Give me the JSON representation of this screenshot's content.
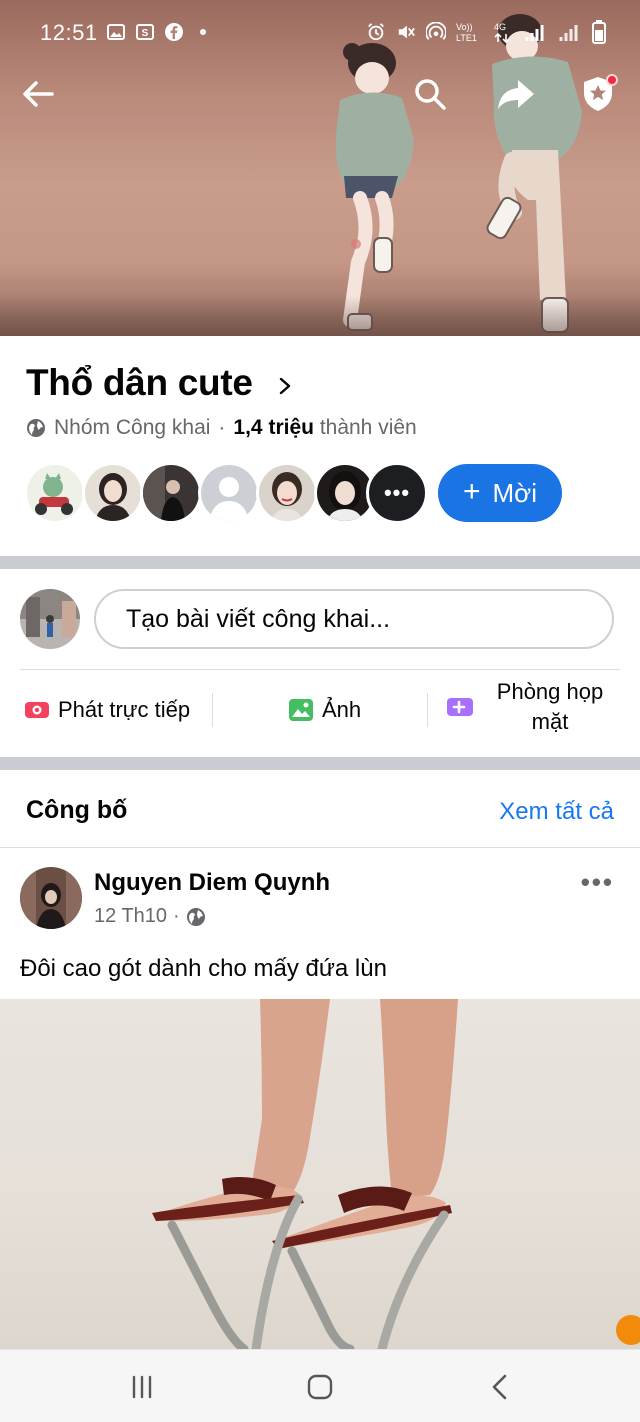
{
  "status_bar": {
    "time": "12:51",
    "left_icons": [
      "gallery-icon",
      "samsung-icon",
      "facebook-icon",
      "dot-icon"
    ],
    "right_icons": [
      "alarm-icon",
      "mute-icon",
      "hotspot-icon",
      "volte-icon",
      "signal-icon",
      "signal-icon",
      "battery-icon"
    ],
    "network_label": "4G",
    "volte_label": "Vo)) LTE1"
  },
  "cover": {
    "back_icon": "back-arrow-icon",
    "search_icon": "search-icon",
    "share_icon": "share-icon",
    "shield_icon": "shield-star-icon"
  },
  "group": {
    "name": "Thổ dân cute",
    "privacy_icon": "globe-icon",
    "privacy": "Nhóm Công khai",
    "separator": "·",
    "member_count": "1,4 triệu",
    "member_suffix": "thành viên",
    "more_members_label": "•••",
    "invite_label": "Mời",
    "invite_plus": "+"
  },
  "composer": {
    "placeholder": "Tạo bài viết công khai...",
    "actions": [
      {
        "label": "Phát trực tiếp",
        "icon": "live-video-icon",
        "color": "#f3425f"
      },
      {
        "label": "Ảnh",
        "icon": "photo-icon",
        "color": "#45bd62"
      },
      {
        "label": "Phòng họp mặt",
        "label_line1": "Phòng họp",
        "label_line2": "mặt",
        "icon": "room-video-icon",
        "color": "#a970ff"
      }
    ]
  },
  "announcements": {
    "title": "Công bố",
    "see_all": "Xem tất cả"
  },
  "post": {
    "author": "Nguyen Diem Quynh",
    "date": "12 Th10",
    "separator": "·",
    "audience_icon": "globe-icon",
    "more_label": "•••",
    "text": "Đôi cao gót dành cho mấy đứa lùn"
  },
  "nav": {
    "recents_icon": "recents-icon",
    "home_icon": "home-icon",
    "back_icon": "back-chevron-icon"
  },
  "colors": {
    "accent": "#1877f2",
    "invite_button": "#1b74e4",
    "secondary_text": "#65676b",
    "divider": "#c9ccd1"
  }
}
